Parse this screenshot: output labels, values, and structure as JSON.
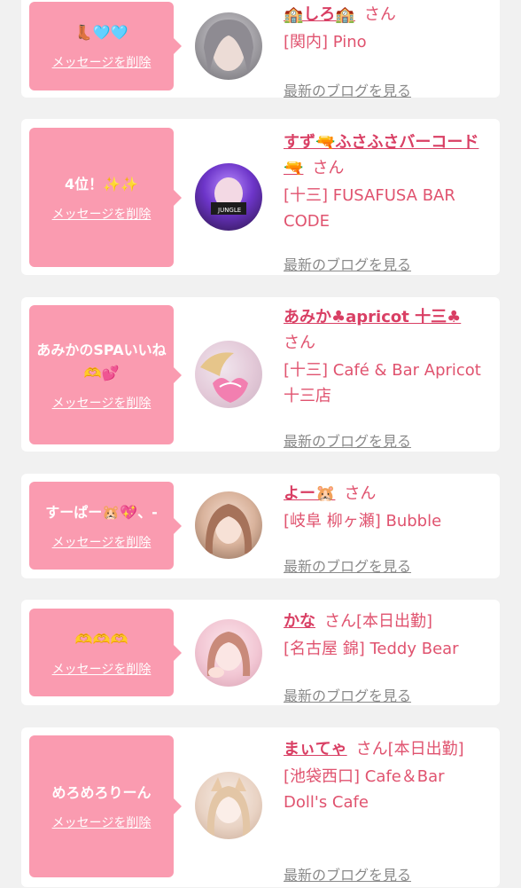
{
  "cards": [
    {
      "message": "👢🩵🩵",
      "delete_label": "メッセージを削除",
      "name": "🏫しろ🏫",
      "honorific": "さん",
      "shop": "[関内] Pino",
      "blog_label": "最新のブログを見る"
    },
    {
      "message": "4位！✨✨",
      "delete_label": "メッセージを削除",
      "name": "すず🔫ふさふさバーコード🔫",
      "honorific": "さん",
      "shop": "[十三] FUSAFUSA BAR CODE",
      "blog_label": "最新のブログを見る"
    },
    {
      "message": "あみかのSPAいいね🫶💕",
      "delete_label": "メッセージを削除",
      "name": "あみか♣apricot 十三♣",
      "honorific": "さん",
      "shop": "[十三] Café & Bar Apricot 十三店",
      "blog_label": "最新のブログを見る"
    },
    {
      "message": "すーぱー🐹💖、-",
      "delete_label": "メッセージを削除",
      "name": "よー🐹",
      "honorific": "さん",
      "shop": "[岐阜 柳ヶ瀬] Bubble",
      "blog_label": "最新のブログを見る"
    },
    {
      "message": "🫶🫶🫶",
      "delete_label": "メッセージを削除",
      "name": "かな",
      "honorific": "さん[本日出勤]",
      "shop": "[名古屋 錦] Teddy Bear",
      "blog_label": "最新のブログを見る"
    },
    {
      "message": "めろめろりーん",
      "delete_label": "メッセージを削除",
      "name": "まぃてゃ",
      "honorific": "さん[本日出勤]",
      "shop": "[池袋西口] Cafe＆Bar Doll's Cafe",
      "blog_label": "最新のブログを見る"
    }
  ],
  "colors": {
    "bubble": "#fa9bb0",
    "name": "#d93f64",
    "text": "#e0536f",
    "link_gray": "#8a8a8a",
    "background": "#f1f1f1"
  }
}
